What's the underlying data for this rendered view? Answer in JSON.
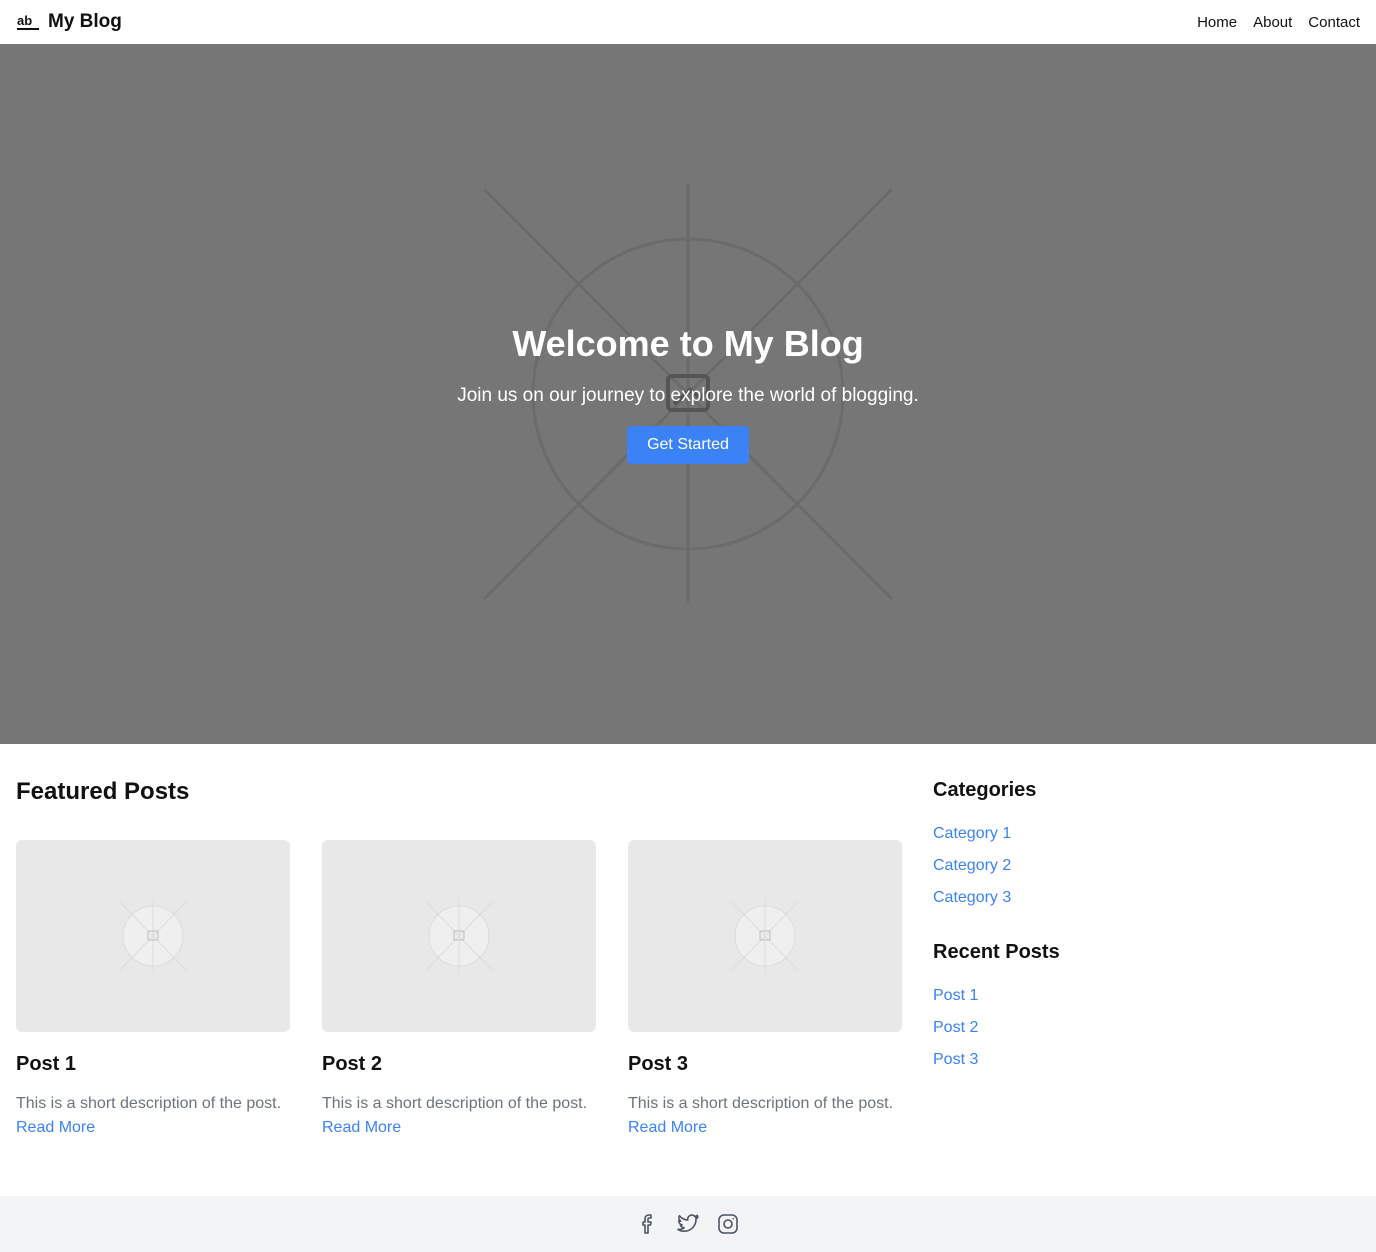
{
  "header": {
    "brand": "My Blog",
    "brand_icon": "ab-logo-icon",
    "nav": [
      {
        "label": "Home"
      },
      {
        "label": "About"
      },
      {
        "label": "Contact"
      }
    ]
  },
  "hero": {
    "title": "Welcome to My Blog",
    "subtitle": "Join us on our journey to explore the world of blogging.",
    "cta": "Get Started",
    "background_icon": "image-placeholder-icon"
  },
  "featured": {
    "title": "Featured Posts",
    "posts": [
      {
        "title": "Post 1",
        "description": "This is a short description of the post.",
        "link": "Read More"
      },
      {
        "title": "Post 2",
        "description": "This is a short description of the post.",
        "link": "Read More"
      },
      {
        "title": "Post 3",
        "description": "This is a short description of the post.",
        "link": "Read More"
      }
    ]
  },
  "sidebar": {
    "categories_title": "Categories",
    "categories": [
      {
        "label": "Category 1"
      },
      {
        "label": "Category 2"
      },
      {
        "label": "Category 3"
      }
    ],
    "recent_title": "Recent Posts",
    "recent": [
      {
        "label": "Post 1"
      },
      {
        "label": "Post 2"
      },
      {
        "label": "Post 3"
      }
    ]
  },
  "footer": {
    "social": [
      "facebook-icon",
      "twitter-icon",
      "instagram-icon"
    ]
  },
  "colors": {
    "accent": "#3b82f6",
    "hero_bg": "#767676",
    "footer_bg": "#f3f4f6",
    "muted_text": "#6b7280"
  }
}
